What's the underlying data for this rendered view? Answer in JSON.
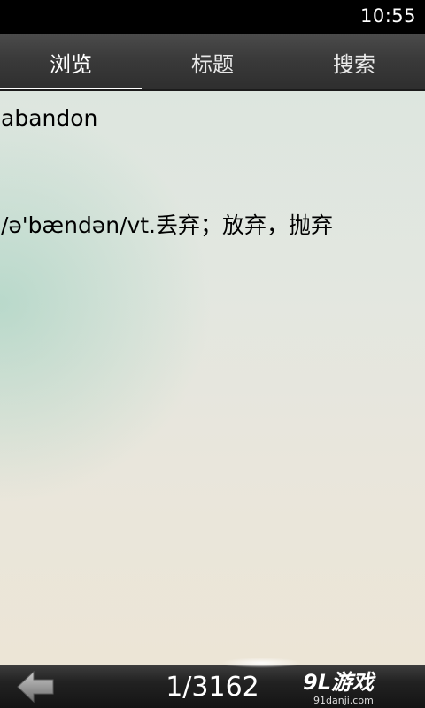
{
  "status_bar": {
    "time": "10:55"
  },
  "tabs": [
    {
      "label": "浏览",
      "active": true
    },
    {
      "label": "标题",
      "active": false
    },
    {
      "label": "搜索",
      "active": false
    }
  ],
  "entry": {
    "word": "abandon",
    "definition": "/ə'bændən/vt.丢弃；放弃，抛弃"
  },
  "footer": {
    "page_counter": "1/3162",
    "prev_icon": "left-arrow-icon"
  },
  "watermark": {
    "brand": "9L游戏",
    "url": "91danji.com"
  },
  "colors": {
    "tab_bar": "#3a3a3a",
    "tab_indicator": "#ffffff",
    "content_bg": "#e6e6dd",
    "accent_teal": "#96cdb9"
  }
}
